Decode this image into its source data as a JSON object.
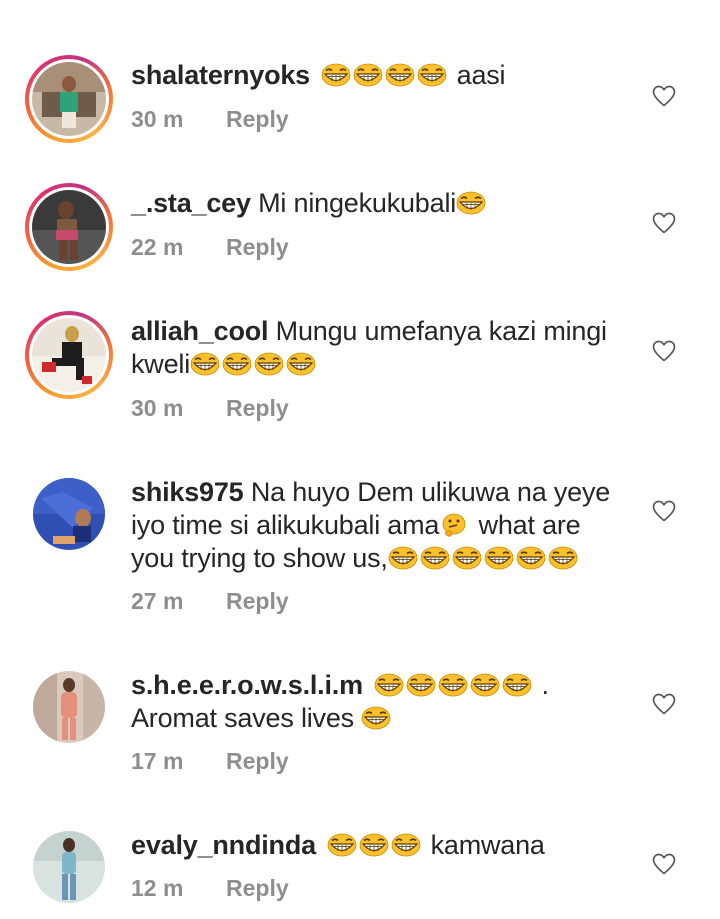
{
  "comments": [
    {
      "username": "shalaternyoks",
      "pre_text": "",
      "emoji_count": 4,
      "post_text": " aasi",
      "lines": null,
      "time": "30 m",
      "reply_label": "Reply",
      "avatar_ring": true
    },
    {
      "username": "_.sta_cey",
      "pre_text": "Mi ningekukubali",
      "emoji_count": 1,
      "post_text": "",
      "time": "22 m",
      "reply_label": "Reply",
      "avatar_ring": true
    },
    {
      "username": "alliah_cool",
      "pre_text": "Mungu umefanya kazi mingi",
      "line2_text": "kweli",
      "emoji_count": 4,
      "post_text": "",
      "time": "30 m",
      "reply_label": "Reply",
      "avatar_ring": true
    },
    {
      "username": "shiks975",
      "pre_text": "Na huyo Dem ulikuwa na yeye",
      "line2_text": "iyo time si alikukubali ama",
      "thinking_emoji": "thinking-face",
      "line2_after": " what are",
      "line3_text": "you trying to show us,",
      "emoji_count": 6,
      "post_text": "",
      "time": "27 m",
      "reply_label": "Reply",
      "avatar_ring": false
    },
    {
      "username": "s.h.e.e.r.o.w.s.l.i.m",
      "pre_text": "",
      "emoji_count": 5,
      "post_text": ".",
      "line2_text": "Aromat saves lives",
      "line2_emoji_count": 1,
      "time": "17 m",
      "reply_label": "Reply",
      "avatar_ring": false
    },
    {
      "username": "evaly_nndinda",
      "pre_text": "",
      "emoji_count": 3,
      "post_text": " kamwana",
      "time": "12 m",
      "reply_label": "Reply",
      "avatar_ring": false
    }
  ],
  "icons": {
    "laugh": "grinning-squinting-face-icon",
    "think": "thinking-face-icon",
    "like": "heart-outline-icon"
  },
  "colors": {
    "text": "#262626",
    "meta": "#8e8e8e",
    "emoji_yellow": "#fbc02d"
  }
}
